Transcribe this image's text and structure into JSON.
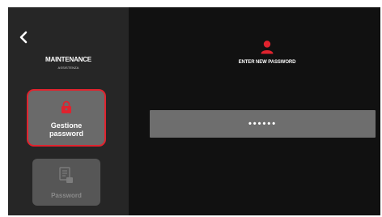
{
  "sidebar": {
    "back_icon": "chevron-left-icon",
    "title": "MAINTENANCE",
    "subtitle": "ASSISTENZA",
    "tiles": [
      {
        "label_line1": "Gestione",
        "label_line2": "password",
        "icon": "lock-icon",
        "state": "selected",
        "accent": "#e0232e"
      },
      {
        "label": "Password",
        "icon": "document-icon",
        "state": "disabled"
      }
    ]
  },
  "main": {
    "user_icon": "user-icon",
    "heading": "ENTER NEW PASSWORD",
    "password_value": "••••••",
    "accent": "#e0232e"
  },
  "colors": {
    "background": "#111111",
    "sidebar": "#262626",
    "field": "#6e6e6e"
  }
}
